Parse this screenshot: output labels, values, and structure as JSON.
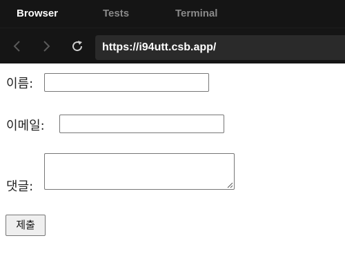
{
  "tabs": [
    {
      "label": "Browser",
      "active": true
    },
    {
      "label": "Tests",
      "active": false
    },
    {
      "label": "Terminal",
      "active": false
    }
  ],
  "nav": {
    "back_icon": "chevron-left-icon",
    "forward_icon": "chevron-right-icon",
    "reload_icon": "reload-icon",
    "url": "https://i94utt.csb.app/"
  },
  "form": {
    "name_label": "이름:",
    "name_value": "",
    "email_label": "이메일:",
    "email_value": "",
    "comment_label": "댓글:",
    "comment_value": "",
    "submit_label": "제출"
  },
  "colors": {
    "chrome_bg": "#151515",
    "url_bg": "#2a2a2a",
    "active_tab": "#ffffff",
    "inactive_tab": "#8a8a8a"
  }
}
